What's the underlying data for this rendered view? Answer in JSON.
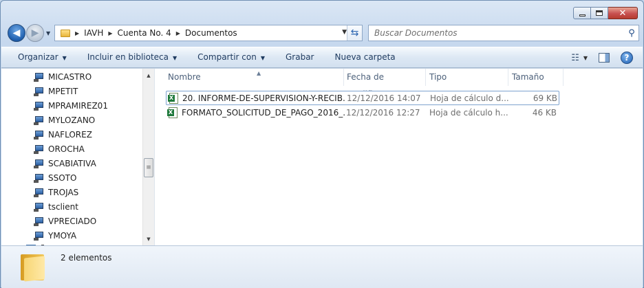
{
  "window": {
    "breadcrumbs": [
      "IAVH",
      "Cuenta No. 4",
      "Documentos"
    ],
    "search_placeholder": "Buscar Documentos"
  },
  "toolbar": {
    "organize": "Organizar",
    "include_library": "Incluir en biblioteca",
    "share_with": "Compartir con",
    "burn": "Grabar",
    "new_folder": "Nueva carpeta"
  },
  "nav_tree": [
    "MICASTRO",
    "MPETIT",
    "MPRAMIREZ01",
    "MYLOZANO",
    "NAFLOREZ",
    "OROCHA",
    "SCABIATIVA",
    "SSOTO",
    "TROJAS",
    "tsclient",
    "VPRECIADO",
    "YMOYA"
  ],
  "columns": {
    "name": "Nombre",
    "date": "Fecha de modifica...",
    "type": "Tipo",
    "size": "Tamaño"
  },
  "files": [
    {
      "name": "20. INFORME-DE-SUPERVISION-Y-RECIB...",
      "date": "12/12/2016 14:07",
      "type": "Hoja de cálculo d...",
      "size": "69 KB",
      "selected": true,
      "icon": "excel-file-icon"
    },
    {
      "name": "FORMATO_SOLICITUD_DE_PAGO_2016_...",
      "date": "12/12/2016 12:27",
      "type": "Hoja de cálculo h...",
      "size": "46 KB",
      "selected": false,
      "icon": "excel-file-icon"
    }
  ],
  "details": {
    "item_count": "2 elementos"
  }
}
